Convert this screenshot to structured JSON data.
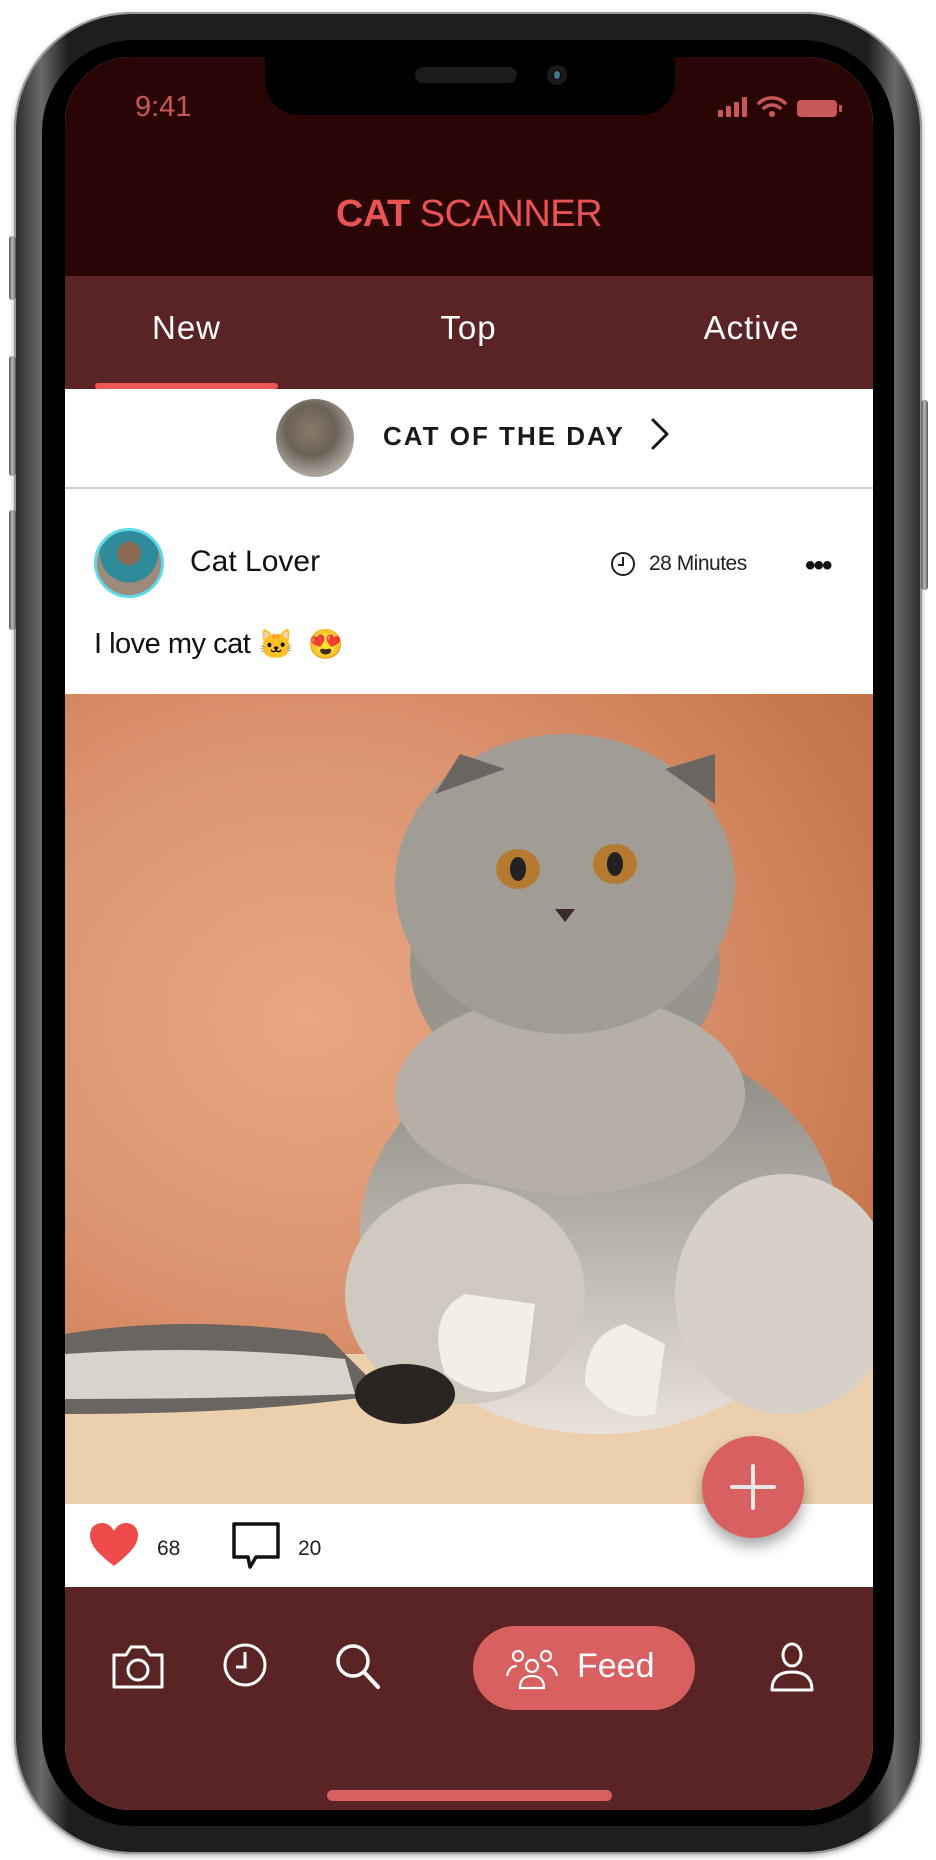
{
  "status_bar": {
    "time": "9:41"
  },
  "header": {
    "title_bold": "CAT",
    "title_rest": " SCANNER"
  },
  "tabs": [
    {
      "label": "New",
      "active": true
    },
    {
      "label": "Top",
      "active": false
    },
    {
      "label": "Active",
      "active": false
    }
  ],
  "cat_of_the_day": {
    "label": "CAT OF THE DAY"
  },
  "post": {
    "user_name": "Cat Lover",
    "time_ago": "28 Minutes",
    "caption": "I love my cat",
    "caption_emojis": [
      "🐱",
      "😍"
    ],
    "likes": "68",
    "comments": "20"
  },
  "bottom_nav": {
    "items": [
      "camera-icon",
      "clock-icon",
      "search-icon",
      "feed",
      "user-icon"
    ],
    "feed_label": "Feed"
  },
  "colors": {
    "header_bg": "#2a0505",
    "tab_bg": "#5a2324",
    "accent": "#d96060",
    "title": "#e85454",
    "avatar_ring": "#5fd8e8"
  }
}
